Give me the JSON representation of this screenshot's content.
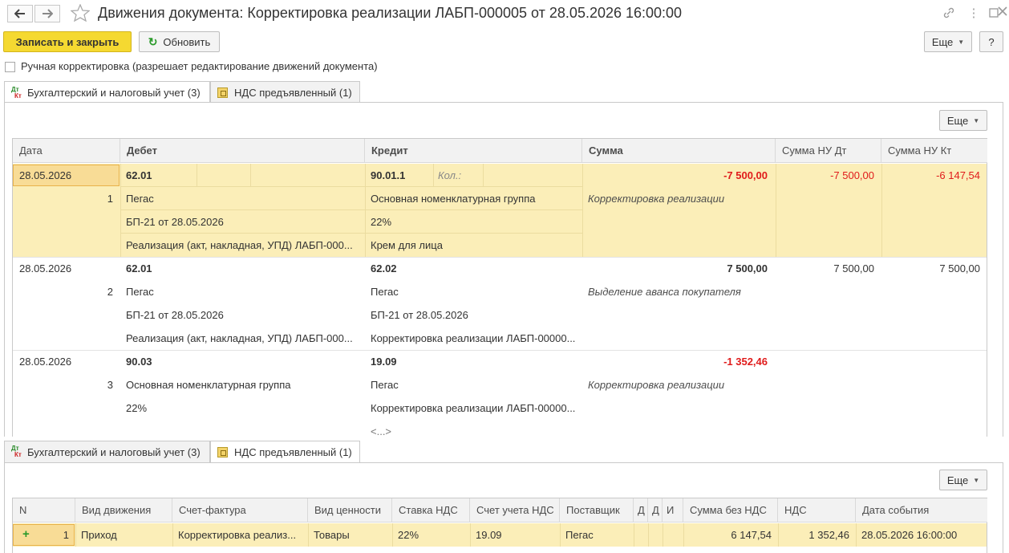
{
  "window": {
    "title": "Движения документа: Корректировка реализации ЛАБП-000005 от 28.05.2026 16:00:00",
    "back_icon": "arrow-left-icon",
    "forward_icon": "arrow-right-icon",
    "favorite_icon": "star-icon",
    "link_icon": "link-icon",
    "menu_icon": "more-vertical-icon",
    "maximize_icon": "maximize-icon",
    "close_icon": "close-icon"
  },
  "toolbar": {
    "save_close_label": "Записать и закрыть",
    "refresh_label": "Обновить",
    "more_label": "Еще",
    "help_label": "?"
  },
  "manual_correction": {
    "label": "Ручная корректировка (разрешает редактирование движений документа)",
    "checked": false
  },
  "tabs": [
    {
      "label": "Бухгалтерский и налоговый учет (3)",
      "icon": "dt-kt-icon",
      "icon_dt": "Дт",
      "icon_kt": "Кт"
    },
    {
      "label": "НДС предъявленный (1)",
      "icon": "register-icon"
    }
  ],
  "acc_table": {
    "more_label": "Еще",
    "columns": [
      "Дата",
      "Дебет",
      "Кредит",
      "Сумма",
      "Сумма НУ Дт",
      "Сумма НУ Кт"
    ],
    "rows": [
      {
        "date": "28.05.2026",
        "num": "1",
        "debit": [
          "62.01",
          "Пегас",
          "БП-21 от 28.05.2026",
          "Реализация (акт, накладная, УПД) ЛАБП-000..."
        ],
        "credit": [
          "90.01.1",
          "Основная номенклатурная группа",
          "22%",
          "Крем для лица"
        ],
        "qty_label": "Кол.:",
        "sum": "-7 500,00",
        "content": "Корректировка реализации",
        "nu_dt": "-7 500,00",
        "nu_kt": "-6 147,54"
      },
      {
        "date": "28.05.2026",
        "num": "2",
        "debit": [
          "62.01",
          "Пегас",
          "БП-21 от 28.05.2026",
          "Реализация (акт, накладная, УПД) ЛАБП-000..."
        ],
        "credit": [
          "62.02",
          "Пегас",
          "БП-21 от 28.05.2026",
          "Корректировка реализации ЛАБП-00000..."
        ],
        "sum": "7 500,00",
        "content": "Выделение аванса покупателя",
        "nu_dt": "7 500,00",
        "nu_kt": "7 500,00"
      },
      {
        "date": "28.05.2026",
        "num": "3",
        "debit": [
          "90.03",
          "Основная номенклатурная группа",
          "22%"
        ],
        "credit": [
          "19.09",
          "Пегас",
          "Корректировка реализации ЛАБП-00000...",
          "<...>"
        ],
        "sum": "-1 352,46",
        "content": "Корректировка реализации"
      }
    ]
  },
  "vat_table": {
    "more_label": "Еще",
    "columns": [
      "N",
      "Вид движения",
      "Счет-фактура",
      "Вид ценности",
      "Ставка НДС",
      "Счет учета НДС",
      "Поставщик",
      "Д",
      "Д",
      "И",
      "Сумма без НДС",
      "НДС",
      "Дата события"
    ],
    "row": {
      "icon": "plus-icon",
      "plus": "+",
      "n": "1",
      "movement": "Приход",
      "invoice": "Корректировка реализ...",
      "value_type": "Товары",
      "rate": "22%",
      "account": "19.09",
      "supplier": "Пегас",
      "sum_no_vat": "6 147,54",
      "vat": "1 352,46",
      "event_date": "28.05.2026 16:00:00"
    }
  },
  "colors": {
    "primary_button": "#f5d931",
    "selected_row": "#fbeeb8",
    "negative": "#e01b1b"
  }
}
